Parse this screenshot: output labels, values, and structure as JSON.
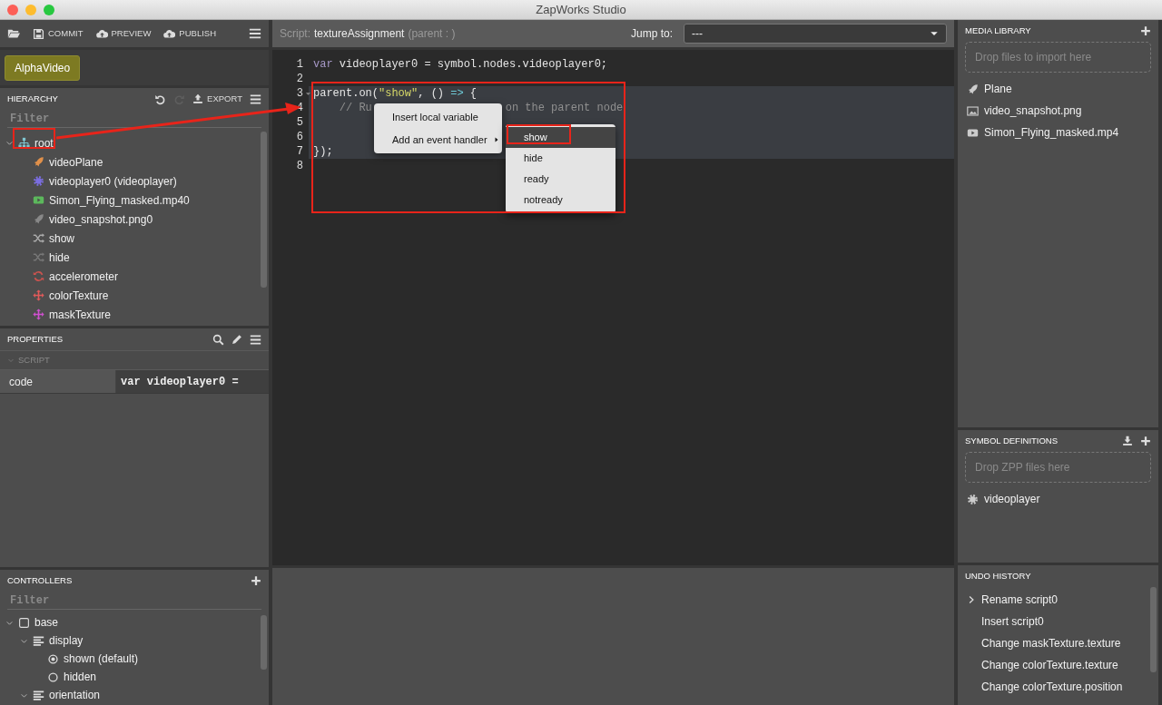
{
  "window": {
    "title": "ZapWorks Studio"
  },
  "toolbar": {
    "buttons": [
      {
        "label": "COMMIT",
        "kind": "save"
      },
      {
        "label": "PREVIEW",
        "kind": "cloud"
      },
      {
        "label": "PUBLISH",
        "kind": "cloud"
      }
    ]
  },
  "project": {
    "name": "AlphaVideo"
  },
  "hierarchy": {
    "title": "HIERARCHY",
    "export_label": "EXPORT",
    "redo_disabled": true,
    "filter_placeholder": "Filter",
    "tree": [
      {
        "label": "root",
        "kind": "hierarchy",
        "color": "#7fc5d0",
        "expanded": true,
        "children": [
          {
            "label": "videoPlane",
            "kind": "rocket",
            "color": "#e0904a"
          },
          {
            "label": "videoplayer0 (videoplayer)",
            "kind": "gear",
            "color": "#7b6ee0"
          },
          {
            "label": "Simon_Flying_masked.mp40",
            "kind": "video",
            "color": "#5cb85c"
          },
          {
            "label": "video_snapshot.png0",
            "kind": "rocket",
            "color": "#888888"
          },
          {
            "label": "show",
            "kind": "shuffle",
            "color": "#aaaaaa"
          },
          {
            "label": "hide",
            "kind": "shuffle",
            "color": "#777777"
          },
          {
            "label": "accelerometer",
            "kind": "refresh",
            "color": "#c9534f"
          },
          {
            "label": "colorTexture",
            "kind": "move",
            "color": "#e05a5a"
          },
          {
            "label": "maskTexture",
            "kind": "move",
            "color": "#d050d0"
          }
        ]
      }
    ]
  },
  "properties": {
    "title": "PROPERTIES",
    "section": "SCRIPT",
    "rows": [
      {
        "key": "code",
        "value": "var videoplayer0 ="
      }
    ]
  },
  "controllers": {
    "title": "CONTROLLERS",
    "filter_placeholder": "Filter",
    "tree": [
      {
        "label": "base",
        "kind": "square",
        "expanded": true,
        "children": [
          {
            "label": "display",
            "kind": "list",
            "expanded": true,
            "children": [
              {
                "label": "shown (default)",
                "kind": "radio",
                "selected": true
              },
              {
                "label": "hidden",
                "kind": "radio",
                "selected": false
              }
            ]
          },
          {
            "label": "orientation",
            "kind": "list",
            "expanded": true
          }
        ]
      }
    ]
  },
  "editor": {
    "script_label": "Script:",
    "script_name": "textureAssignment",
    "parent_label": "(parent : )",
    "jump_label": "Jump to:",
    "jump_value": "---",
    "lines": [
      {
        "number": "1",
        "highlighted": false,
        "tokens": [
          {
            "kind": "keyword",
            "text": "var"
          },
          {
            "kind": "plain",
            "text": " videoplayer0 = symbol.nodes.videoplayer0;"
          }
        ]
      },
      {
        "number": "2",
        "highlighted": false
      },
      {
        "number": "3",
        "highlighted": true,
        "foldable": true,
        "tokens": [
          {
            "kind": "plain",
            "text": "parent.on("
          },
          {
            "kind": "string",
            "text": "\"show\""
          },
          {
            "kind": "plain",
            "text": ", () "
          },
          {
            "kind": "operator",
            "text": "=>"
          },
          {
            "kind": "plain",
            "text": " {"
          }
        ]
      },
      {
        "number": "4",
        "highlighted": true,
        "tokens": [
          {
            "kind": "comment",
            "text": "    // Ru"
          },
          {
            "kind": "comment",
            "text": "on the parent node",
            "after_gap": true
          }
        ]
      },
      {
        "number": "5",
        "highlighted": true
      },
      {
        "number": "6",
        "highlighted": true
      },
      {
        "number": "7",
        "highlighted": true,
        "tokens": [
          {
            "kind": "plain",
            "text": "});"
          }
        ]
      },
      {
        "number": "8",
        "highlighted": false
      }
    ]
  },
  "context_menu": {
    "items": [
      {
        "label": "Insert local variable",
        "submenu": false
      },
      {
        "label": "Add an event handler",
        "submenu": true
      }
    ]
  },
  "submenu": {
    "items": [
      {
        "label": "show",
        "selected": true
      },
      {
        "label": "hide",
        "selected": false
      },
      {
        "label": "ready",
        "selected": false
      },
      {
        "label": "notready",
        "selected": false
      }
    ]
  },
  "media_library": {
    "title": "MEDIA LIBRARY",
    "drop_placeholder": "Drop files to import here",
    "items": [
      {
        "label": "Plane",
        "kind": "rocket"
      },
      {
        "label": "video_snapshot.png",
        "kind": "image"
      },
      {
        "label": "Simon_Flying_masked.mp4",
        "kind": "video"
      }
    ]
  },
  "symbol_definitions": {
    "title": "SYMBOL DEFINITIONS",
    "drop_placeholder": "Drop ZPP files here",
    "items": [
      {
        "label": "videoplayer",
        "kind": "gear"
      }
    ]
  },
  "undo_history": {
    "title": "UNDO HISTORY",
    "items": [
      {
        "label": "Rename script0",
        "current": true
      },
      {
        "label": "Insert script0",
        "current": false
      },
      {
        "label": "Change maskTexture.texture",
        "current": false
      },
      {
        "label": "Change colorTexture.texture",
        "current": false
      },
      {
        "label": "Change colorTexture.position",
        "current": false
      }
    ]
  }
}
